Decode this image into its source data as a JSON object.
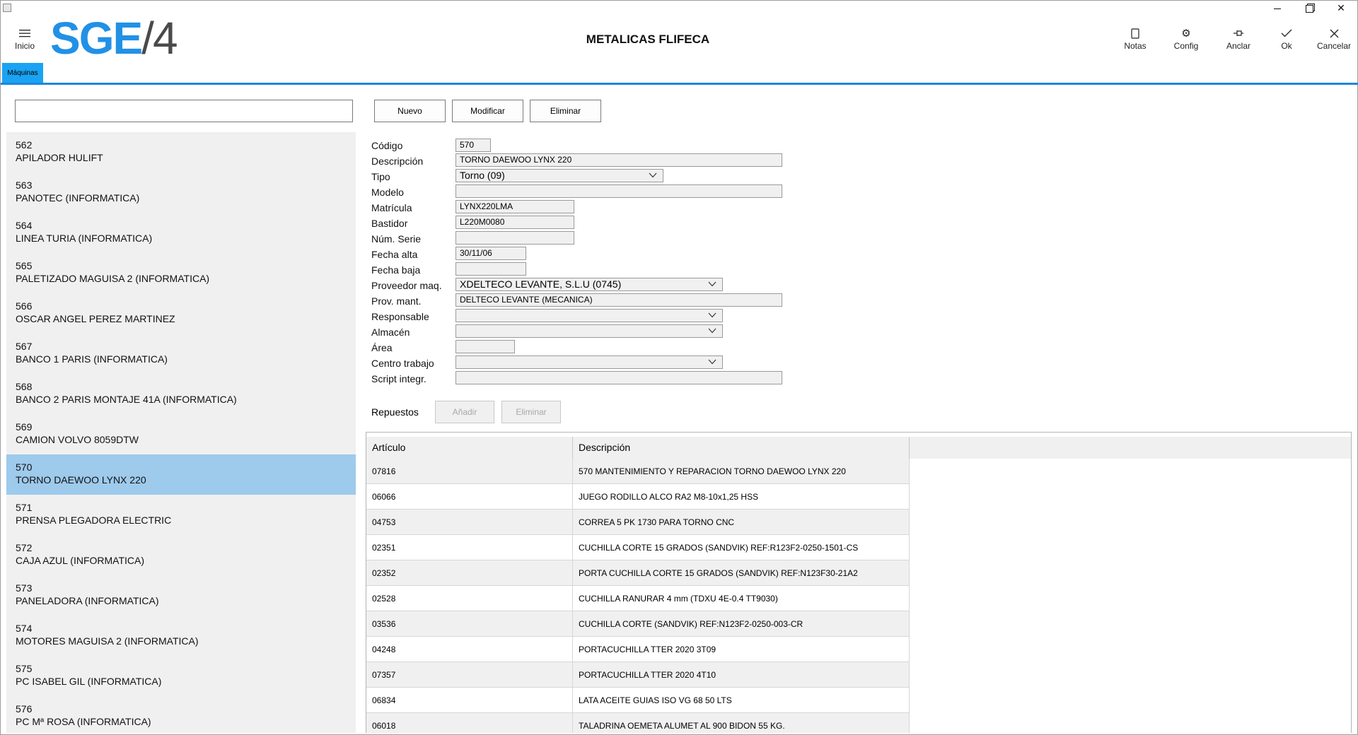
{
  "window": {
    "title": "METALICAS FLIFECA"
  },
  "header": {
    "menu_label": "Inicio",
    "logo_a": "SGE",
    "logo_b": "/4",
    "actions": [
      {
        "label": "Notas",
        "icon": "notes-icon"
      },
      {
        "label": "Config",
        "icon": "gear-icon"
      },
      {
        "label": "Anclar",
        "icon": "pin-icon"
      },
      {
        "label": "Ok",
        "icon": "check-icon"
      },
      {
        "label": "Cancelar",
        "icon": "close-icon"
      }
    ]
  },
  "tabs": [
    {
      "label": "Máquinas",
      "active": true
    }
  ],
  "toolbar": {
    "search_value": "",
    "nuevo": "Nuevo",
    "modificar": "Modificar",
    "eliminar": "Eliminar"
  },
  "machines": [
    {
      "code": "562",
      "name": "APILADOR HULIFT"
    },
    {
      "code": "563",
      "name": "PANOTEC (INFORMATICA)"
    },
    {
      "code": "564",
      "name": "LINEA TURIA (INFORMATICA)"
    },
    {
      "code": "565",
      "name": "PALETIZADO MAGUISA 2 (INFORMATICA)"
    },
    {
      "code": "566",
      "name": "OSCAR ANGEL PEREZ MARTINEZ"
    },
    {
      "code": "567",
      "name": "BANCO 1 PARIS (INFORMATICA)"
    },
    {
      "code": "568",
      "name": "BANCO 2 PARIS MONTAJE 41A (INFORMATICA)"
    },
    {
      "code": "569",
      "name": "CAMION VOLVO 8059DTW"
    },
    {
      "code": "570",
      "name": "TORNO DAEWOO LYNX 220",
      "selected": true
    },
    {
      "code": "571",
      "name": "PRENSA PLEGADORA ELECTRIC"
    },
    {
      "code": "572",
      "name": "CAJA AZUL (INFORMATICA)"
    },
    {
      "code": "573",
      "name": "PANELADORA (INFORMATICA)"
    },
    {
      "code": "574",
      "name": "MOTORES MAGUISA 2 (INFORMATICA)"
    },
    {
      "code": "575",
      "name": "PC ISABEL GIL (INFORMATICA)"
    },
    {
      "code": "576",
      "name": "PC Mª ROSA (INFORMATICA)"
    }
  ],
  "form": {
    "codigo": {
      "label": "Código",
      "value": "570"
    },
    "descripcion": {
      "label": "Descripción",
      "value": "TORNO DAEWOO LYNX 220"
    },
    "tipo": {
      "label": "Tipo",
      "value": "Torno (09)"
    },
    "modelo": {
      "label": "Modelo",
      "value": ""
    },
    "matricula": {
      "label": "Matrícula",
      "value": "LYNX220LMA"
    },
    "bastidor": {
      "label": "Bastidor",
      "value": "L220M0080"
    },
    "num_serie": {
      "label": "Núm. Serie",
      "value": ""
    },
    "fecha_alta": {
      "label": "Fecha alta",
      "value": "30/11/06"
    },
    "fecha_baja": {
      "label": "Fecha baja",
      "value": ""
    },
    "proveedor_maq": {
      "label": "Proveedor maq.",
      "value": "XDELTECO LEVANTE, S.L.U (0745)"
    },
    "prov_mant": {
      "label": "Prov. mant.",
      "value": "DELTECO LEVANTE (MECANICA)"
    },
    "responsable": {
      "label": "Responsable",
      "value": ""
    },
    "almacen": {
      "label": "Almacén",
      "value": ""
    },
    "area": {
      "label": "Área",
      "value": ""
    },
    "centro_trabajo": {
      "label": "Centro trabajo",
      "value": ""
    },
    "script_integr": {
      "label": "Script integr.",
      "value": ""
    }
  },
  "repuestos": {
    "label": "Repuestos",
    "add": "Añadir",
    "remove": "Eliminar",
    "columns": [
      "Artículo",
      "Descripción"
    ],
    "rows": [
      {
        "articulo": "07816",
        "descripcion": "570 MANTENIMIENTO Y REPARACION TORNO DAEWOO LYNX 220"
      },
      {
        "articulo": "06066",
        "descripcion": "JUEGO RODILLO ALCO RA2 M8-10x1,25 HSS"
      },
      {
        "articulo": "04753",
        "descripcion": "CORREA  5 PK 1730 PARA TORNO CNC"
      },
      {
        "articulo": "02351",
        "descripcion": "CUCHILLA CORTE 15 GRADOS (SANDVIK) REF:R123F2-0250-1501-CS"
      },
      {
        "articulo": "02352",
        "descripcion": "PORTA CUCHILLA CORTE 15 GRADOS (SANDVIK) REF:N123F30-21A2"
      },
      {
        "articulo": "02528",
        "descripcion": "CUCHILLA RANURAR 4 mm (TDXU 4E-0.4 TT9030)"
      },
      {
        "articulo": "03536",
        "descripcion": "CUCHILLA CORTE (SANDVIK) REF:N123F2-0250-003-CR"
      },
      {
        "articulo": "04248",
        "descripcion": "PORTACUCHILLA TTER 2020 3T09"
      },
      {
        "articulo": "07357",
        "descripcion": "PORTACUCHILLA TTER 2020 4T10"
      },
      {
        "articulo": "06834",
        "descripcion": "LATA ACEITE GUIAS ISO VG 68 50 LTS"
      },
      {
        "articulo": "06018",
        "descripcion": "TALADRINA OEMETA ALUMET AL 900 BIDON 55 KG."
      }
    ]
  },
  "colors": {
    "accent": "#1b88dd",
    "tab": "#1aa3f2",
    "selection": "#9ecaec"
  }
}
